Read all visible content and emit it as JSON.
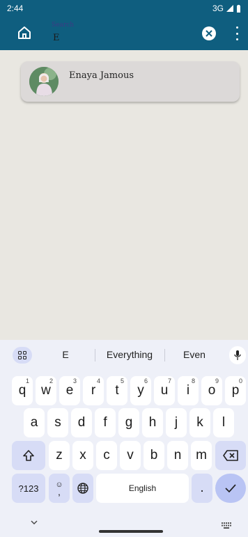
{
  "status_bar": {
    "time": "2:44",
    "network": "3G"
  },
  "app_bar": {
    "search_placeholder": "Search",
    "search_value": "E"
  },
  "results": [
    {
      "name": "Enaya Jamous"
    }
  ],
  "keyboard": {
    "suggestions": [
      "E",
      "Everything",
      "Even"
    ],
    "row1": [
      {
        "label": "q",
        "hint": "1"
      },
      {
        "label": "w",
        "hint": "2"
      },
      {
        "label": "e",
        "hint": "3"
      },
      {
        "label": "r",
        "hint": "4"
      },
      {
        "label": "t",
        "hint": "5"
      },
      {
        "label": "y",
        "hint": "6"
      },
      {
        "label": "u",
        "hint": "7"
      },
      {
        "label": "i",
        "hint": "8"
      },
      {
        "label": "o",
        "hint": "9"
      },
      {
        "label": "p",
        "hint": "0"
      }
    ],
    "row2": [
      "a",
      "s",
      "d",
      "f",
      "g",
      "h",
      "j",
      "k",
      "l"
    ],
    "row3": [
      "z",
      "x",
      "c",
      "v",
      "b",
      "n",
      "m"
    ],
    "symbols_label": "?123",
    "comma_label": ",",
    "space_label": "English",
    "period_label": "."
  },
  "colors": {
    "app_bar": "#0f5e7f",
    "background": "#e9e7e1",
    "card": "#dcd9d8",
    "keyboard": "#eef0f8",
    "accent": "#b9c4f4"
  }
}
